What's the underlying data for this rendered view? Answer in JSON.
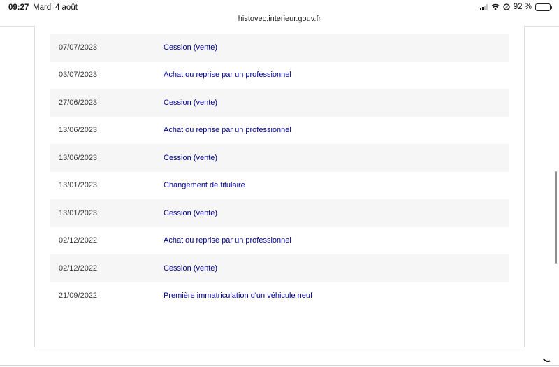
{
  "status_bar": {
    "time": "09:27",
    "date": "Mardi 4 août",
    "battery_text": "92 %",
    "battery_level": 0.92,
    "icons": [
      "signal-icon",
      "wifi-icon",
      "location-icon",
      "battery-icon"
    ]
  },
  "browser": {
    "url": "histovec.interieur.gouv.fr"
  },
  "history": {
    "rows": [
      {
        "date": "07/07/2023",
        "event": "Cession (vente)"
      },
      {
        "date": "03/07/2023",
        "event": "Achat ou reprise par un professionnel"
      },
      {
        "date": "27/06/2023",
        "event": "Cession (vente)"
      },
      {
        "date": "13/06/2023",
        "event": "Achat ou reprise par un professionnel"
      },
      {
        "date": "13/06/2023",
        "event": "Cession (vente)"
      },
      {
        "date": "13/01/2023",
        "event": "Changement de titulaire"
      },
      {
        "date": "13/01/2023",
        "event": "Cession (vente)"
      },
      {
        "date": "02/12/2022",
        "event": "Achat ou reprise par un professionnel"
      },
      {
        "date": "02/12/2022",
        "event": "Cession (vente)"
      },
      {
        "date": "21/09/2022",
        "event": "Première immatriculation d'un véhicule neuf"
      }
    ]
  },
  "colors": {
    "event_text": "#000091",
    "row_stripe": "#f6f6f6",
    "date_text": "#3a3a3a"
  }
}
